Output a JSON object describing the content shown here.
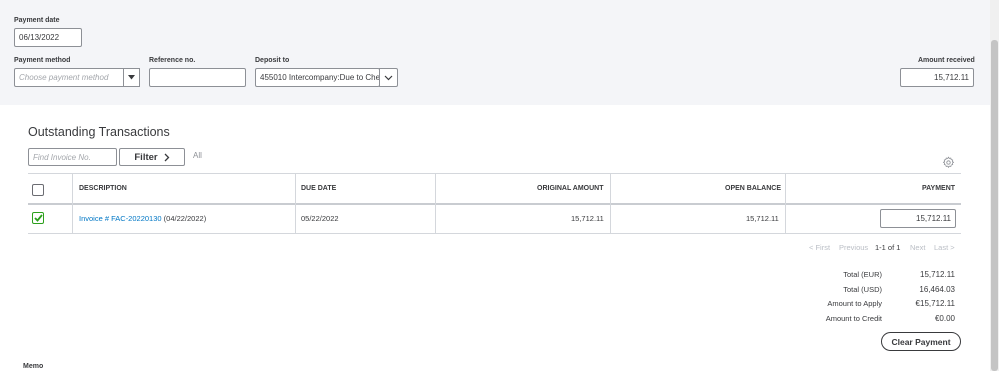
{
  "payment": {
    "date_label": "Payment date",
    "date_value": "06/13/2022",
    "method_label": "Payment method",
    "method_placeholder": "Choose payment method",
    "reference_label": "Reference no.",
    "reference_value": "",
    "deposit_label": "Deposit to",
    "deposit_value": "455010 Intercompany:Due to Che",
    "amount_label": "Amount received",
    "amount_value": "15,712.11"
  },
  "outstanding": {
    "title": "Outstanding Transactions",
    "find_placeholder": "Find Invoice No.",
    "filter_label": "Filter",
    "all_label": "All",
    "columns": {
      "description": "DESCRIPTION",
      "due_date": "DUE DATE",
      "original_amount": "ORIGINAL AMOUNT",
      "open_balance": "OPEN BALANCE",
      "payment": "PAYMENT"
    },
    "rows": [
      {
        "checked": true,
        "invoice_link": "Invoice # FAC-20220130",
        "invoice_date": "(04/22/2022)",
        "due_date": "05/22/2022",
        "original_amount": "15,712.11",
        "open_balance": "15,712.11",
        "payment": "15,712.11"
      }
    ]
  },
  "pagination": {
    "first": "< First",
    "previous": "Previous",
    "range": "1-1 of 1",
    "next": "Next",
    "last": "Last >"
  },
  "totals": {
    "total_eur_label": "Total (EUR)",
    "total_eur_value": "15,712.11",
    "total_usd_label": "Total (USD)",
    "total_usd_value": "16,464.03",
    "apply_label": "Amount to Apply",
    "apply_value": "€15,712.11",
    "credit_label": "Amount to Credit",
    "credit_value": "€0.00"
  },
  "clear_payment_label": "Clear Payment",
  "memo_label": "Memo",
  "icons": {
    "dropdown": "caret-down-icon",
    "filter_arrow": "chevron-right-icon",
    "settings": "gear-icon",
    "check": "checkmark-icon"
  },
  "colors": {
    "panel_bg": "#f4f5f8",
    "link": "#0077c5",
    "check_green": "#2ca01c"
  }
}
